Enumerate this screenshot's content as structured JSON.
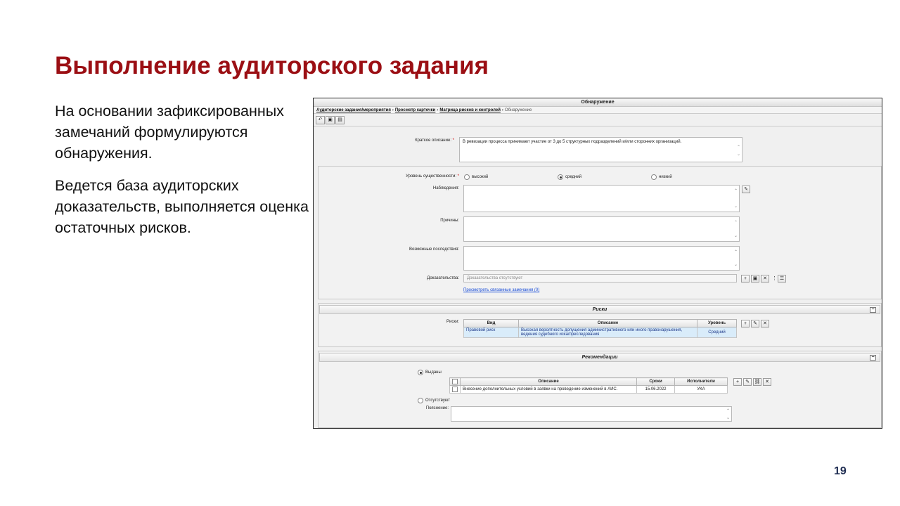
{
  "slide": {
    "title": "Выполнение аудиторского задания",
    "paragraph1": "На основании зафиксированных замечаний формулируются обнаружения.",
    "paragraph2": "Ведется база аудиторских доказательств, выполняется оценка остаточных рисков.",
    "page_number": "19"
  },
  "window": {
    "title": "Обнаружение",
    "breadcrumbs": [
      "Аудиторские задания/мероприятия",
      "Просмотр карточки",
      "Матрица рисков и контролей"
    ],
    "breadcrumb_current": "Обнаружение",
    "breadcrumb_sep": "›",
    "toolbar_icons": [
      "back-icon",
      "save-icon",
      "save-close-icon"
    ],
    "toolbar_glyphs": [
      "↶",
      "▣",
      "▤"
    ]
  },
  "form": {
    "short_desc_label": "Краткое описание:",
    "required_mark": "*",
    "short_desc_value": "В ревизации процесса принимают участие от 3 до 5 структурных подразделений и/или сторонних организаций.",
    "significance_label": "Уровень существенности:",
    "significance_options": [
      "высокий",
      "средний",
      "низкий"
    ],
    "significance_selected": "средний",
    "observations_label": "Наблюдения:",
    "causes_label": "Причины:",
    "consequences_label": "Возможные последствия:",
    "evidence_label": "Доказательства:",
    "evidence_placeholder": "Доказательства отсутствуют",
    "related_link": "Просмотреть связанные замечания (0)",
    "scroll_up": "⌃",
    "scroll_down": "⌄",
    "edit_glyph": "✎",
    "add_glyph": "+",
    "save_glyph": "▣",
    "delete_glyph": "✕",
    "more_glyph": "⋮",
    "list_glyph": "☰",
    "link_glyph": "⛓"
  },
  "risks": {
    "section_title": "Риски",
    "label": "Риски:",
    "collapse": "−",
    "columns": [
      "Вид",
      "Описание",
      "Уровень"
    ],
    "rows": [
      {
        "type": "Правовой риск",
        "description": "Высокая вероятность допущения административного или иного правонарушения, ведения судебного иска/преследования",
        "level": "Средний"
      }
    ]
  },
  "recommendations": {
    "section_title": "Рекомендации",
    "collapse": "−",
    "issued_label": "Выданы",
    "absent_label": "Отсутствуют",
    "selected": "Выданы",
    "columns": [
      "Описание",
      "Сроки",
      "Исполнители"
    ],
    "rows": [
      {
        "description": "Внесение дополнительных условий в заявки на проведение изменений в АИС.",
        "deadline": "15.06.2022",
        "executor": "УКА"
      }
    ],
    "explanation_label": "Пояснение:"
  }
}
